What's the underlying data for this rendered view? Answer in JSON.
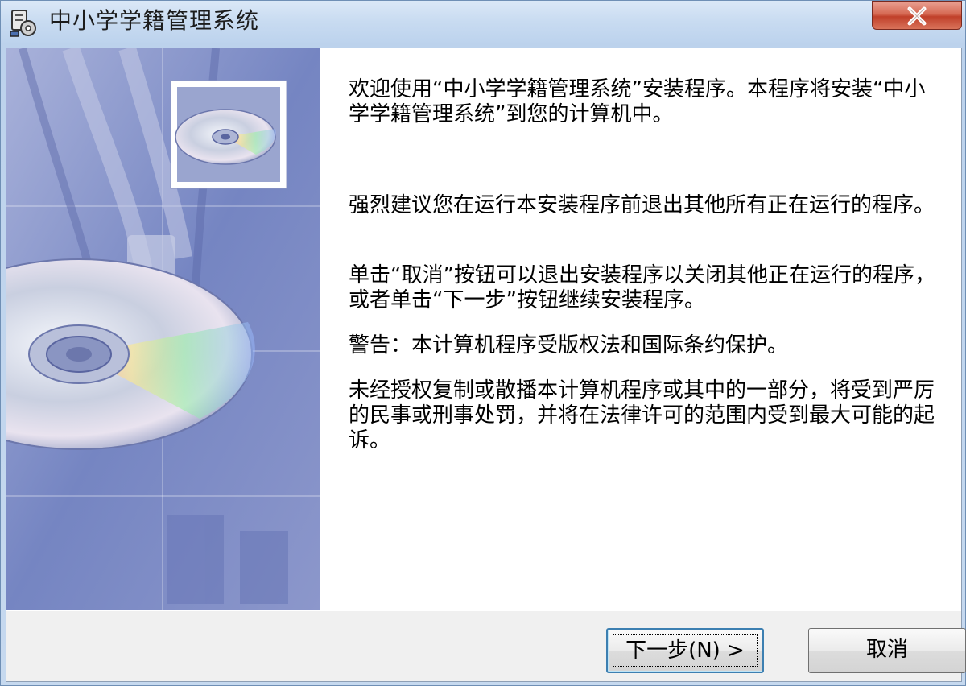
{
  "window": {
    "title": "中小学学籍管理系统",
    "icon": "installer-icon",
    "close_icon": "close-icon"
  },
  "banner": {
    "image": "cd-disc-artwork",
    "thumbnail": "cd-disc-icon"
  },
  "content": {
    "paragraphs": [
      "欢迎使用“中小学学籍管理系统”安装程序。本程序将安装“中小学学籍管理系统”到您的计算机中。",
      "强烈建议您在运行本安装程序前退出其他所有正在运行的程序。",
      "单击“取消”按钮可以退出安装程序以关闭其他正在运行的程序，或者单击“下一步”按钮继续安装程序。",
      "警告：本计算机程序受版权法和国际条约保护。",
      "未经授权复制或散播本计算机程序或其中的一部分，将受到严厉的民事或刑事处罚，并将在法律许可的范围内受到最大可能的起诉。"
    ]
  },
  "buttons": {
    "next_label": "下一步(N) >",
    "cancel_label": "取消"
  },
  "colors": {
    "banner_blue": "#7e8dc4",
    "close_red": "#c0402a",
    "default_button_border": "#3c7fb1"
  }
}
